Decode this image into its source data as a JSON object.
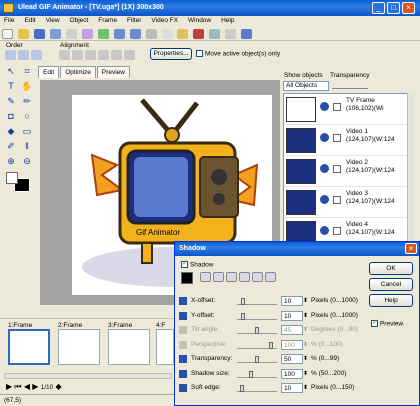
{
  "window": {
    "title": "Ulead GIF Animator - [TV.uga*] (1X) 300x300",
    "buttons": [
      "_",
      "□",
      "×"
    ]
  },
  "menu": [
    "File",
    "Edit",
    "View",
    "Object",
    "Frame",
    "Filter",
    "Video FX",
    "Window",
    "Help"
  ],
  "toolbar": {
    "order_label": "Order",
    "alignment_label": "Alignment",
    "properties_label": "Properties...",
    "move_active_label": "Move active object(s) only"
  },
  "canvas_tabs": [
    "Edit",
    "Optimize",
    "Preview"
  ],
  "objects_panel": {
    "show_objects_label": "Show objects",
    "transparency_label": "Transparency",
    "filter_value": "All Objects",
    "items": [
      {
        "name": "TV Frame",
        "coords": "(106,102)(Wi"
      },
      {
        "name": "Video 1",
        "coords": "(124,107)(W:124"
      },
      {
        "name": "Video 2",
        "coords": "(124,107)(W:124"
      },
      {
        "name": "Video 3",
        "coords": "(124,107)(W:124"
      },
      {
        "name": "Video 4",
        "coords": "(124,107)(W:124"
      }
    ]
  },
  "frames": [
    {
      "label": "1:Frame"
    },
    {
      "label": "2:Frame"
    },
    {
      "label": "3:Frame"
    },
    {
      "label": "4:F"
    }
  ],
  "playback": {
    "counter": "1/10"
  },
  "status": {
    "coords": "(67,5)"
  },
  "tv_caption": "Gif Animator",
  "dialog": {
    "title": "Shadow",
    "shadow_label": "Shadow",
    "ok_label": "OK",
    "cancel_label": "Cancel",
    "help_label": "Help",
    "preview_label": "Preview",
    "rows": [
      {
        "label": "X-offset:",
        "value": "10",
        "range": "Pixels (0...1000)",
        "enabled": true,
        "pos": 0.1
      },
      {
        "label": "Y-offset:",
        "value": "10",
        "range": "Pixels (0...1000)",
        "enabled": true,
        "pos": 0.1
      },
      {
        "label": "Tilt angle:",
        "value": "45",
        "range": "Degrees (0...90)",
        "enabled": false,
        "pos": 0.5
      },
      {
        "label": "Perspective:",
        "value": "100",
        "range": "% (0...100)",
        "enabled": false,
        "pos": 0.9
      },
      {
        "label": "Transparency:",
        "value": "50",
        "range": "% (0...99)",
        "enabled": true,
        "pos": 0.5
      },
      {
        "label": "Shadow size:",
        "value": "100",
        "range": "% (50...200)",
        "enabled": true,
        "pos": 0.33
      },
      {
        "label": "Soft edge:",
        "value": "10",
        "range": "Pixels (0...150)",
        "enabled": true,
        "pos": 0.07
      }
    ]
  }
}
